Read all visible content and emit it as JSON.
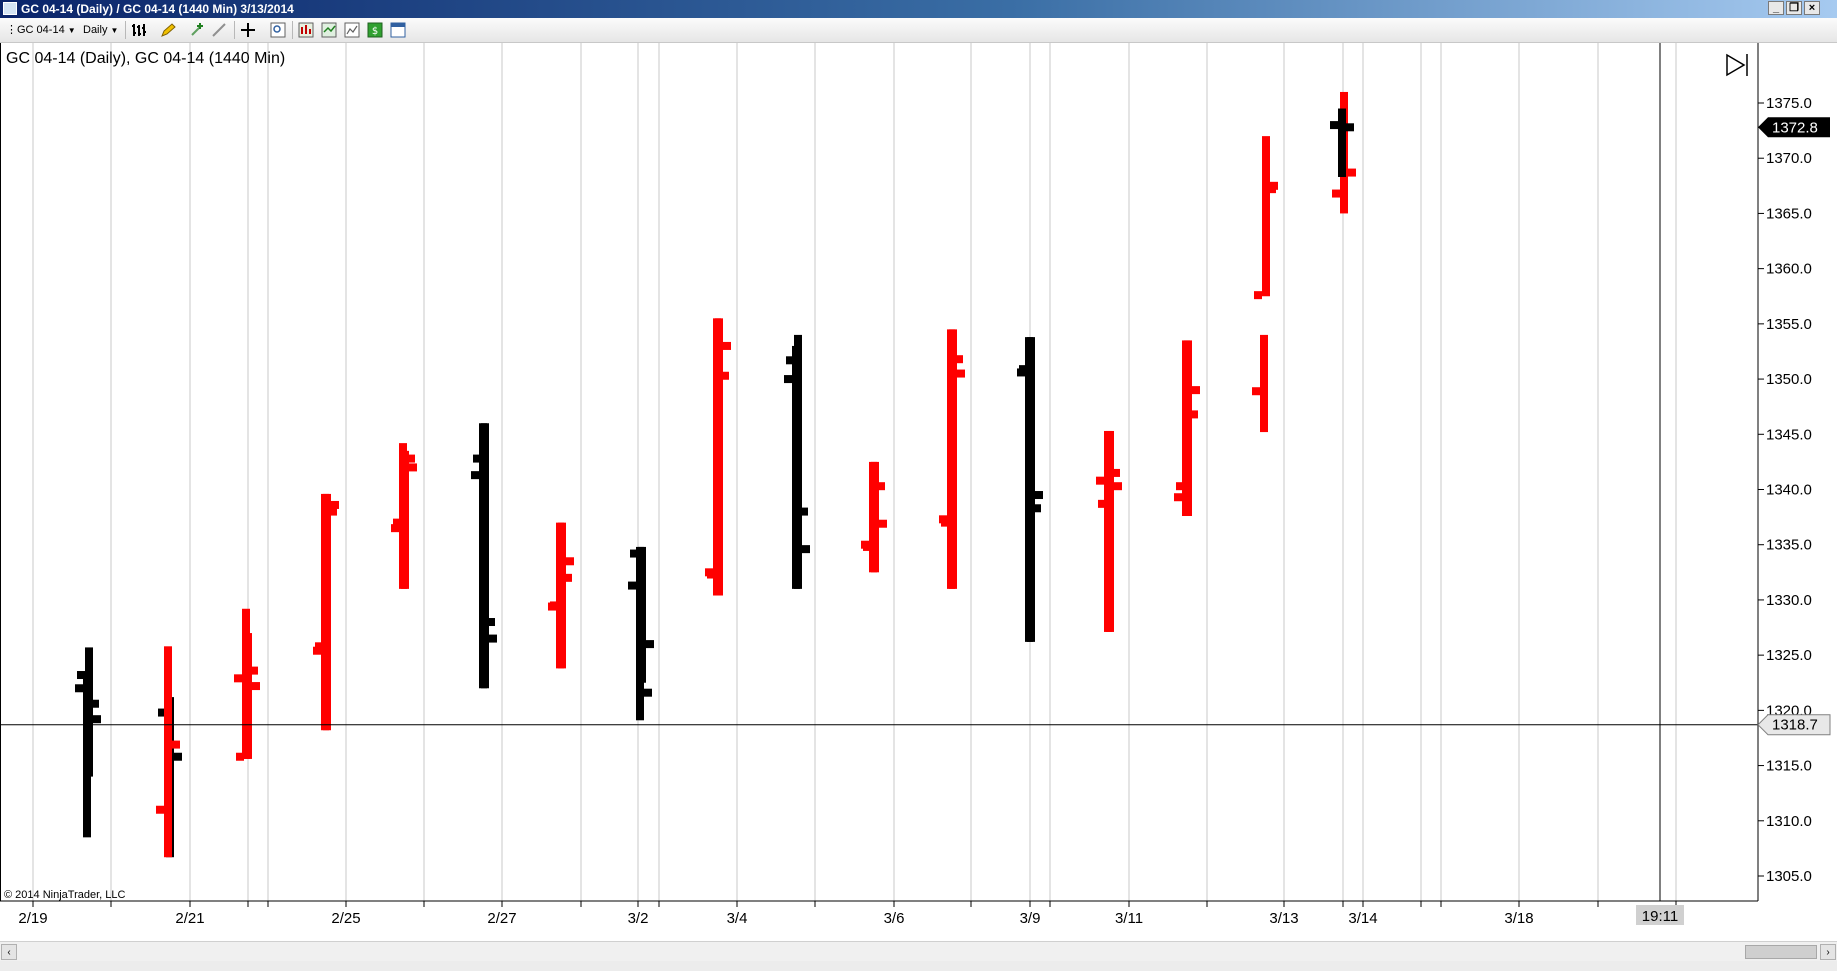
{
  "window": {
    "title": "GC 04-14 (Daily) / GC 04-14 (1440 Min)  3/13/2014",
    "controls": [
      "minimize",
      "restore",
      "close"
    ]
  },
  "toolbar": {
    "instrument_label": "GC 04-14",
    "interval_label": "Daily",
    "icons": [
      "bars-type-icon",
      "pencil-draw-icon",
      "plus-tool-icon",
      "line-tool-icon",
      "crosshair-icon",
      "zoom-icon",
      "indicators-icon",
      "strategies-icon",
      "chart-properties-icon",
      "dollar-icon",
      "panel-icon"
    ]
  },
  "chart_title": "GC 04-14 (Daily), GC 04-14 (1440 Min)",
  "copyright": "© 2014 NinjaTrader, LLC",
  "scrollbar": {
    "left_arrow": "‹",
    "right_arrow": "›"
  },
  "colors": {
    "up_bar": "#ff0000",
    "down_bar": "#000000",
    "grid": "#c8c8c8",
    "crosshair": "#000000",
    "last_price_bg": "#000000",
    "crosshair_label_bg": "#e8e8e8"
  },
  "chart_data": {
    "type": "bar",
    "style": "OHLC (overlaid daily and 1440-min series)",
    "ylim": [
      1302,
      1378
    ],
    "yticks": [
      1305.0,
      1310.0,
      1315.0,
      1320.0,
      1325.0,
      1330.0,
      1335.0,
      1340.0,
      1345.0,
      1350.0,
      1355.0,
      1360.0,
      1365.0,
      1370.0,
      1375.0
    ],
    "ytick_labels": [
      "1305.0",
      "1310.0",
      "1315.0",
      "1320.0",
      "1325.0",
      "1330.0",
      "1335.0",
      "1340.0",
      "1345.0",
      "1350.0",
      "1355.0",
      "1360.0",
      "1365.0",
      "1370.0",
      "1375.0"
    ],
    "xtick_labels": [
      "2/19",
      "2/21",
      "2/25",
      "2/27",
      "3/2",
      "3/4",
      "3/6",
      "3/9",
      "3/11",
      "3/13",
      "3/14",
      "3/18"
    ],
    "last_price": {
      "value": 1372.8,
      "label": "1372.8"
    },
    "crosshair": {
      "price": 1318.7,
      "price_label": "1318.7",
      "time_label": "19:11"
    },
    "grid": true,
    "series": [
      {
        "name": "GC 04-14 (Daily)",
        "color_up": "#ff0000",
        "color_down": "#000000",
        "bars": [
          {
            "date": "2/19",
            "open": 1323.2,
            "high": 1325.7,
            "low": 1314.0,
            "close": 1319.2
          },
          {
            "date": "2/20",
            "open": 1319.8,
            "high": 1321.2,
            "low": 1306.7,
            "close": 1315.8
          },
          {
            "date": "2/21",
            "open": 1315.8,
            "high": 1327.0,
            "low": 1315.6,
            "close": 1322.2
          },
          {
            "date": "2/24",
            "open": 1325.8,
            "high": 1339.6,
            "low": 1318.2,
            "close": 1338.6
          },
          {
            "date": "2/25",
            "open": 1337.0,
            "high": 1343.5,
            "low": 1331.0,
            "close": 1342.0
          },
          {
            "date": "2/26",
            "open": 1342.8,
            "high": 1346.0,
            "low": 1322.0,
            "close": 1326.5
          },
          {
            "date": "2/27",
            "open": 1329.5,
            "high": 1337.0,
            "low": 1323.8,
            "close": 1333.5
          },
          {
            "date": "2/28",
            "open": 1334.2,
            "high": 1334.8,
            "low": 1322.5,
            "close": 1326.0
          },
          {
            "date": "3/3",
            "open": 1332.3,
            "high": 1355.5,
            "low": 1330.4,
            "close": 1353.0
          },
          {
            "date": "3/4",
            "open": 1351.7,
            "high": 1354.0,
            "low": 1331.0,
            "close": 1334.6
          },
          {
            "date": "3/5",
            "open": 1334.8,
            "high": 1342.5,
            "low": 1332.5,
            "close": 1336.9
          },
          {
            "date": "3/6",
            "open": 1337.0,
            "high": 1354.5,
            "low": 1331.0,
            "close": 1350.5
          },
          {
            "date": "3/7",
            "open": 1350.9,
            "high": 1353.8,
            "low": 1326.2,
            "close": 1339.5
          },
          {
            "date": "3/10",
            "open": 1338.7,
            "high": 1345.3,
            "low": 1327.1,
            "close": 1340.3
          },
          {
            "date": "3/11",
            "open": 1340.3,
            "high": 1353.5,
            "low": 1337.6,
            "close": 1349.0
          },
          {
            "date": "3/12",
            "open": 1357.6,
            "high": 1372.0,
            "low": 1357.5,
            "close": 1367.5
          },
          {
            "date": "3/13",
            "open": 1366.8,
            "high": 1376.0,
            "low": 1365.0,
            "close": 1368.7
          }
        ]
      },
      {
        "name": "GC 04-14 (1440 Min)",
        "color_up": "#ff0000",
        "color_down": "#000000",
        "bars": [
          {
            "date": "2/19",
            "open": 1322.0,
            "high": 1323.5,
            "low": 1308.5,
            "close": 1320.6
          },
          {
            "date": "2/20",
            "open": 1311.0,
            "high": 1325.8,
            "low": 1306.7,
            "close": 1316.9
          },
          {
            "date": "2/21",
            "open": 1322.9,
            "high": 1329.2,
            "low": 1315.6,
            "close": 1323.6
          },
          {
            "date": "2/24",
            "open": 1325.4,
            "high": 1339.6,
            "low": 1318.2,
            "close": 1338.0
          },
          {
            "date": "2/25",
            "open": 1336.5,
            "high": 1344.2,
            "low": 1331.0,
            "close": 1342.8
          },
          {
            "date": "2/26",
            "open": 1341.3,
            "high": 1346.0,
            "low": 1322.0,
            "close": 1328.0
          },
          {
            "date": "2/27",
            "open": 1329.4,
            "high": 1337.0,
            "low": 1323.8,
            "close": 1332.0
          },
          {
            "date": "2/28",
            "open": 1331.3,
            "high": 1334.8,
            "low": 1319.1,
            "close": 1321.6
          },
          {
            "date": "3/3",
            "open": 1332.5,
            "high": 1355.5,
            "low": 1330.4,
            "close": 1350.3
          },
          {
            "date": "3/4",
            "open": 1350.0,
            "high": 1353.0,
            "low": 1331.0,
            "close": 1338.0
          },
          {
            "date": "3/5",
            "open": 1335.0,
            "high": 1342.5,
            "low": 1332.5,
            "close": 1340.3
          },
          {
            "date": "3/6",
            "open": 1337.3,
            "high": 1354.5,
            "low": 1331.0,
            "close": 1351.8
          },
          {
            "date": "3/7",
            "open": 1350.6,
            "high": 1353.8,
            "low": 1326.2,
            "close": 1338.3
          },
          {
            "date": "3/10",
            "open": 1340.8,
            "high": 1345.3,
            "low": 1327.1,
            "close": 1341.5
          },
          {
            "date": "3/11",
            "open": 1339.3,
            "high": 1353.5,
            "low": 1337.6,
            "close": 1346.8
          },
          {
            "date": "3/12",
            "open": 1348.9,
            "high": 1354.0,
            "low": 1345.2,
            "close": 1367.2
          },
          {
            "date": "3/13",
            "open": 1373.0,
            "high": 1374.5,
            "low": 1368.3,
            "close": 1372.8
          }
        ]
      }
    ]
  }
}
